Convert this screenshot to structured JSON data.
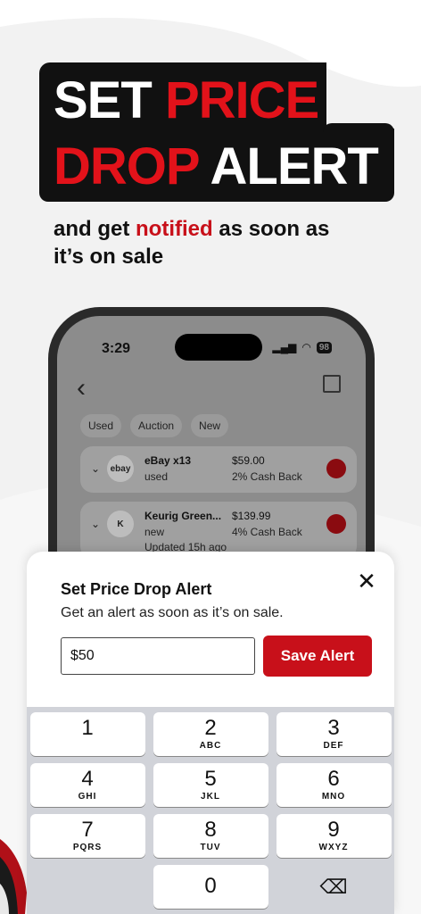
{
  "headline": {
    "line1_white": "SET",
    "line1_red": "PRICE",
    "line2_red": "DROP",
    "line2_white": "ALERT"
  },
  "subhead": {
    "pre": "and get ",
    "highlight": "notified",
    "post": " as soon as it’s on sale"
  },
  "status_bar": {
    "time": "3:29",
    "battery": "98"
  },
  "filters": [
    "Used",
    "Auction",
    "New"
  ],
  "listings": [
    {
      "logo": "ebay",
      "name": "eBay x13",
      "condition": "used",
      "price": "$59.00",
      "cashback": "2% Cash Back",
      "updated": ""
    },
    {
      "logo": "K",
      "name": "Keurig Green...",
      "condition": "new",
      "price": "$139.99",
      "cashback": "4% Cash Back",
      "updated": "Updated 15h ago"
    }
  ],
  "sheet": {
    "title": "Set Price Drop Alert",
    "subtitle": "Get an alert as soon as it’s on sale.",
    "input_value": "$50",
    "save_label": "Save Alert"
  },
  "keypad": [
    {
      "num": "1",
      "letters": ""
    },
    {
      "num": "2",
      "letters": "ABC"
    },
    {
      "num": "3",
      "letters": "DEF"
    },
    {
      "num": "4",
      "letters": "GHI"
    },
    {
      "num": "5",
      "letters": "JKL"
    },
    {
      "num": "6",
      "letters": "MNO"
    },
    {
      "num": "7",
      "letters": "PQRS"
    },
    {
      "num": "8",
      "letters": "TUV"
    },
    {
      "num": "9",
      "letters": "WXYZ"
    },
    {
      "num": "0",
      "letters": ""
    }
  ],
  "colors": {
    "accent": "#c8101a",
    "banner": "#111111"
  }
}
